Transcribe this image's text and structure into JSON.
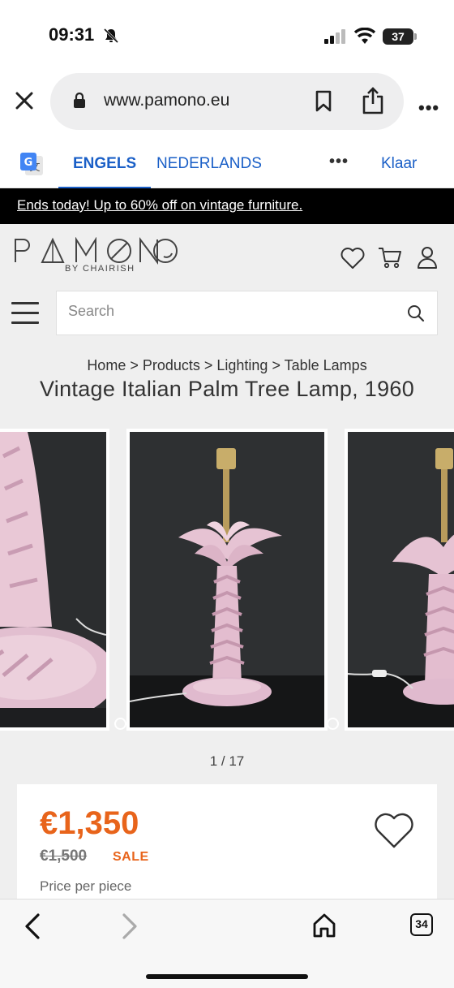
{
  "status_bar": {
    "time": "09:31",
    "battery": "37"
  },
  "browser": {
    "url": "www.pamono.eu"
  },
  "translate_bar": {
    "source_language": "ENGELS",
    "target_language": "NEDERLANDS",
    "done_label": "Klaar"
  },
  "promo": {
    "text": "Ends today! Up to 60% off on vintage furniture."
  },
  "site": {
    "logo_text": "PAMONO",
    "logo_subtext": "BY CHAIRISH",
    "search_placeholder": "Search",
    "breadcrumb": "Home > Products > Lighting > Table Lamps",
    "product_title": "Vintage Italian Palm Tree Lamp, 1960",
    "gallery_counter": "1 / 17"
  },
  "price_card": {
    "price": "€1,350",
    "old_price": "€1,500",
    "sale_label": "SALE",
    "price_note": "Price per piece"
  },
  "toolbar": {
    "tab_count": "34"
  },
  "colors": {
    "accent_orange": "#e8641b",
    "translate_blue": "#1a5fc7",
    "promo_bg": "#000000",
    "site_bg": "#efefef"
  }
}
